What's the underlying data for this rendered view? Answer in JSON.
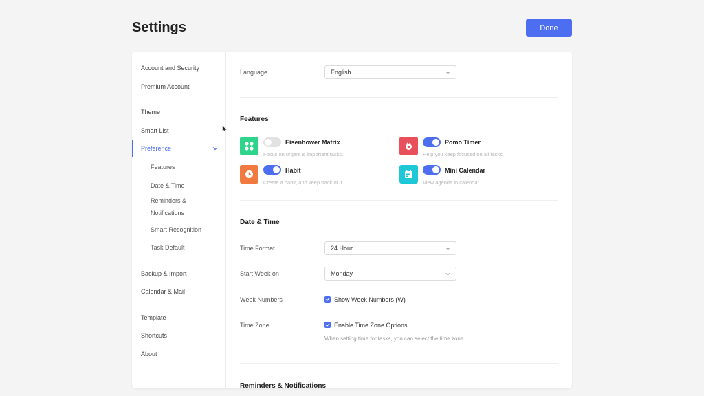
{
  "header": {
    "title": "Settings",
    "done_label": "Done"
  },
  "sidebar": {
    "items": [
      {
        "label": "Account and Security"
      },
      {
        "label": "Premium Account"
      },
      {
        "label": "Theme"
      },
      {
        "label": "Smart List"
      },
      {
        "label": "Preference"
      },
      {
        "label": "Features"
      },
      {
        "label": "Date & Time"
      },
      {
        "label": "Reminders &",
        "label2": "Notifications"
      },
      {
        "label": "Smart Recognition"
      },
      {
        "label": "Task Default"
      },
      {
        "label": "Backup & Import"
      },
      {
        "label": "Calendar & Mail"
      },
      {
        "label": "Template"
      },
      {
        "label": "Shortcuts"
      },
      {
        "label": "About"
      }
    ],
    "active": "Preference"
  },
  "language": {
    "label": "Language",
    "value": "English"
  },
  "features": {
    "title": "Features",
    "items": [
      {
        "name": "Eisenhower Matrix",
        "desc": "Focus on urgent & important tasks.",
        "enabled": false,
        "icon": "matrix-icon",
        "color": "#2ed48a"
      },
      {
        "name": "Pomo Timer",
        "desc": "Help you keep focused on all tasks.",
        "enabled": true,
        "icon": "pomo-icon",
        "color": "#e8505b"
      },
      {
        "name": "Habit",
        "desc": "Create a habit, and keep track of it.",
        "enabled": true,
        "icon": "clock-icon",
        "color": "#f07a3f"
      },
      {
        "name": "Mini Calendar",
        "desc": "View agenda in calendar.",
        "enabled": true,
        "icon": "calendar-icon",
        "color": "#1ec8d6"
      }
    ]
  },
  "date_time": {
    "title": "Date & Time",
    "time_format_label": "Time Format",
    "time_format_value": "24 Hour",
    "start_week_label": "Start Week on",
    "start_week_value": "Monday",
    "week_numbers_label": "Week Numbers",
    "week_numbers_check": "Show Week Numbers (W)",
    "time_zone_label": "Time Zone",
    "time_zone_check": "Enable Time Zone Options",
    "time_zone_hint": "When setting time for tasks, you can select the time zone."
  },
  "reminders": {
    "title": "Reminders & Notifications"
  },
  "colors": {
    "accent": "#4d6ef0"
  }
}
